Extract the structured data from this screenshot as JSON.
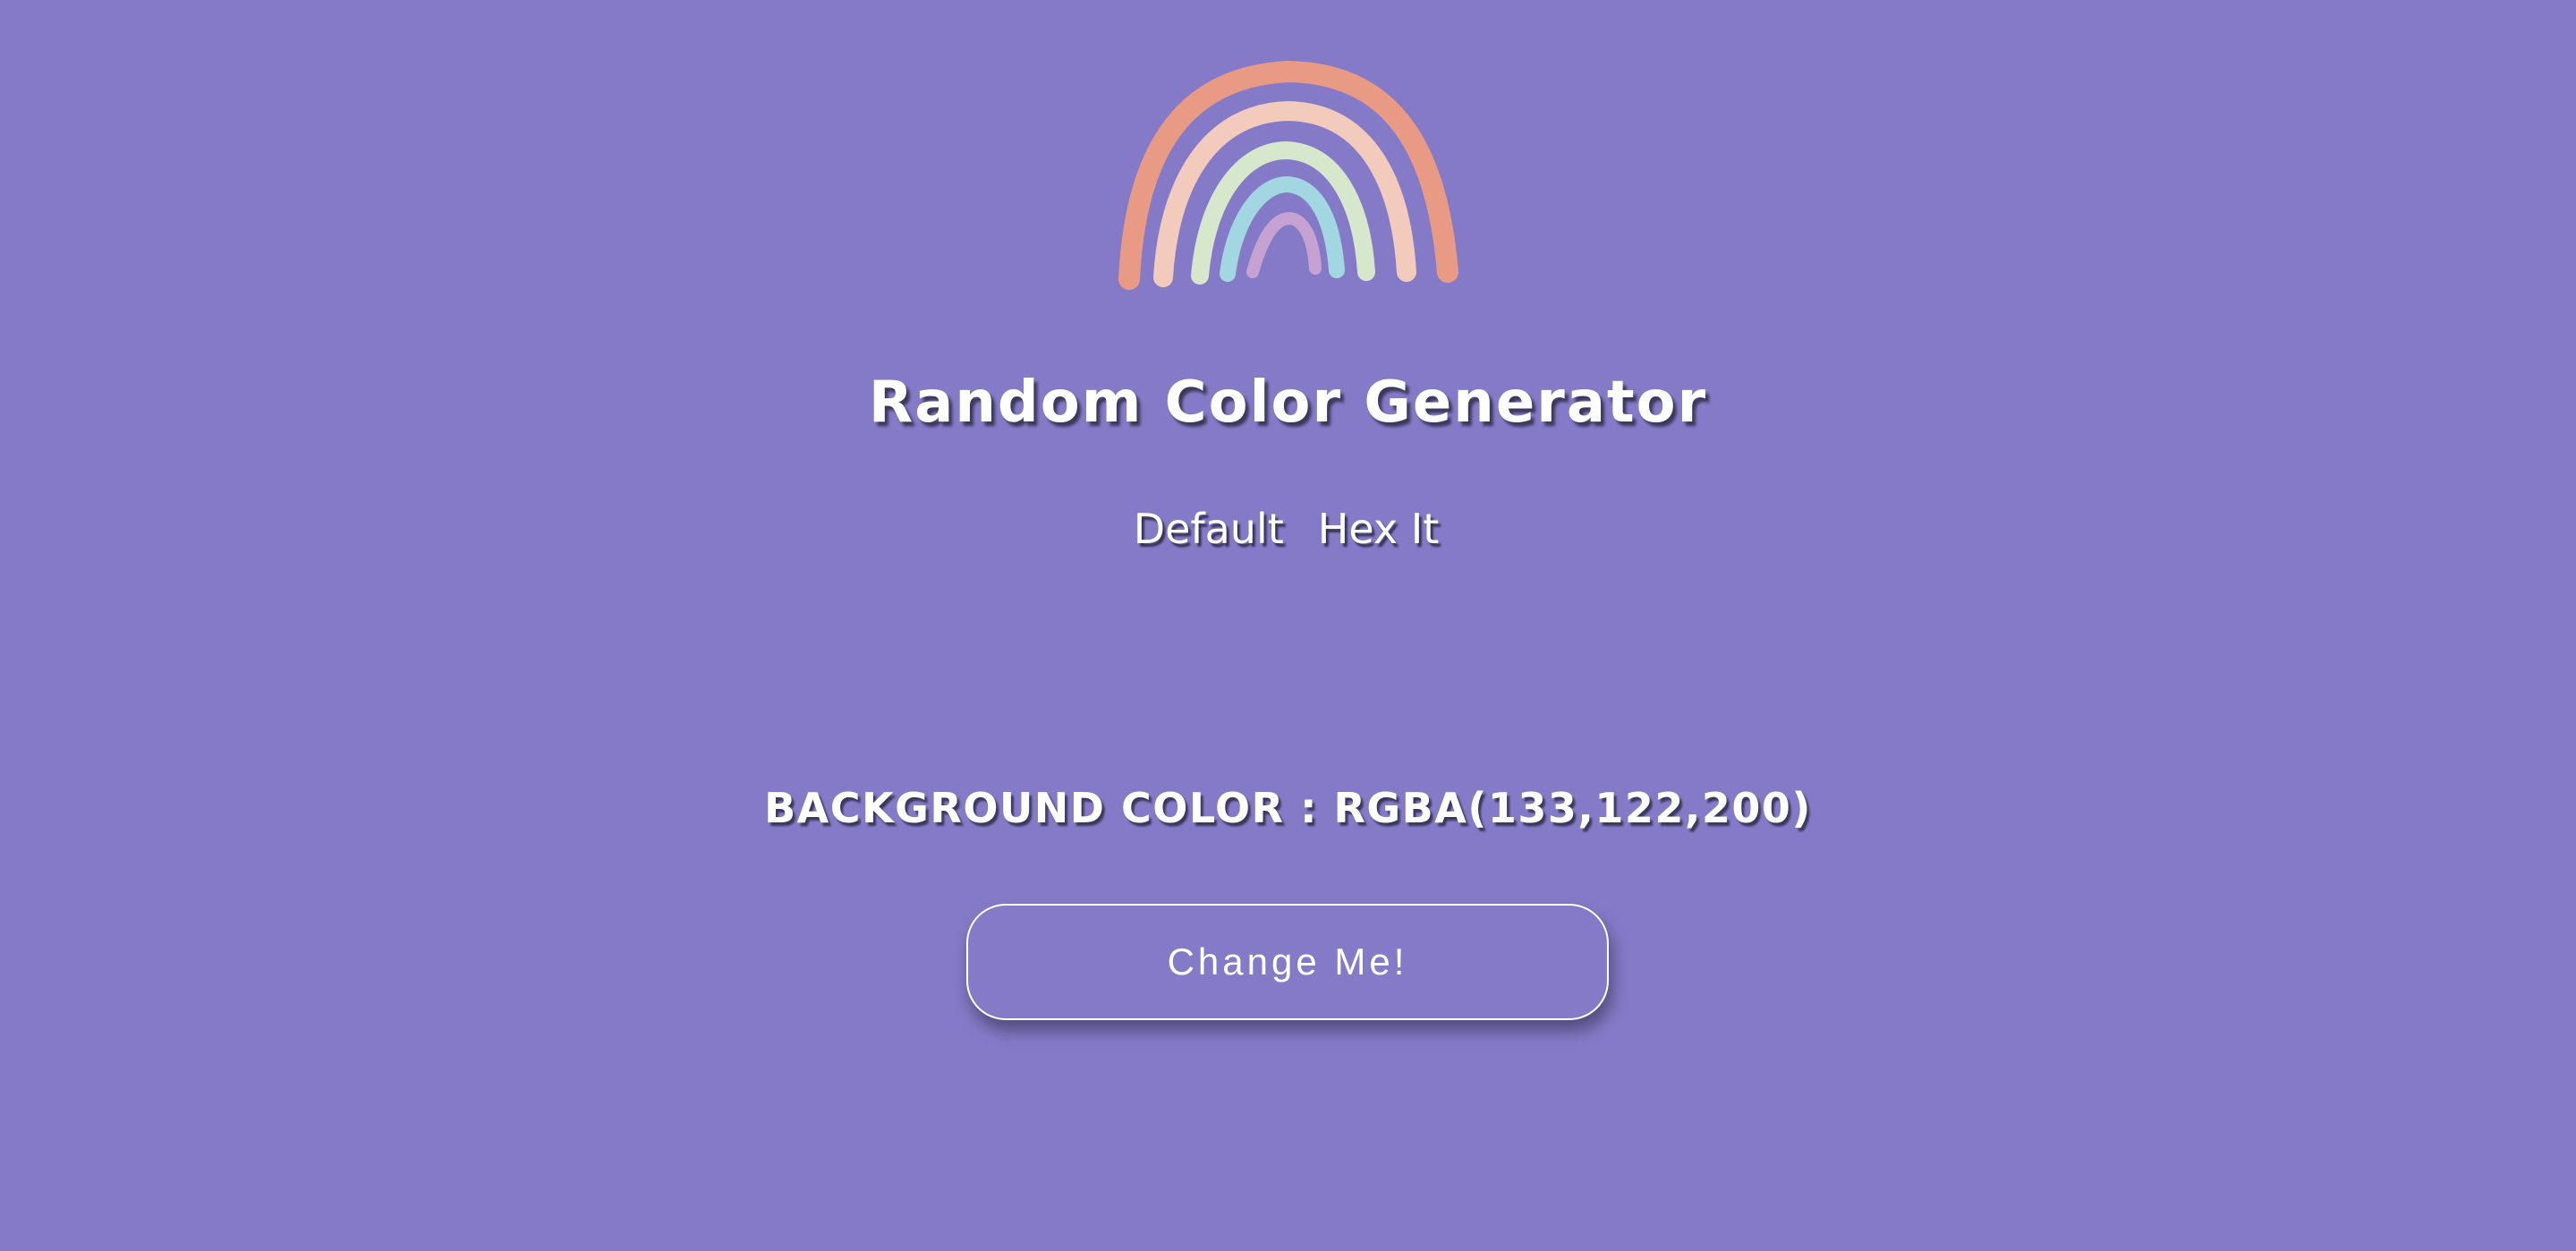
{
  "logo": {
    "icon": "rainbow-icon",
    "colors": [
      "#E99A85",
      "#F2CBBD",
      "#D7E7CC",
      "#A2D6E0",
      "#C5A2D2"
    ]
  },
  "header": {
    "title": "Random Color Generator"
  },
  "nav": {
    "items": [
      {
        "label": "Default"
      },
      {
        "label": "Hex It"
      }
    ]
  },
  "main": {
    "background_label": "BACKGROUND COLOR : RGBA(133,122,200)",
    "button_label": "Change Me!"
  },
  "colors": {
    "background": "#857AC8",
    "text": "#FFFFFF"
  }
}
